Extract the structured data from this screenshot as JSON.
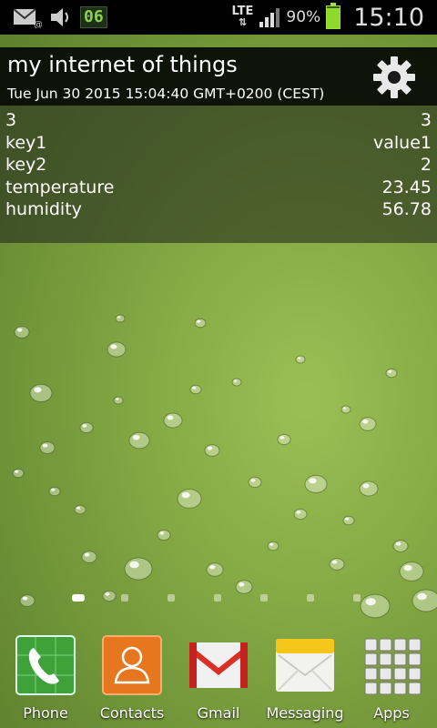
{
  "status_bar": {
    "notification_badge": "06",
    "network_type": "LTE",
    "battery_percent": "90%",
    "battery_level": 0.9,
    "clock": "15:10",
    "icons": [
      "email-notification-icon",
      "volume-icon",
      "signal-icon",
      "battery-icon"
    ]
  },
  "widget": {
    "title": "my internet of things",
    "timestamp": "Tue Jun 30 2015 15:04:40 GMT+0200 (CEST)",
    "settings_icon": "gear-icon",
    "rows": [
      {
        "key": "3",
        "value": "3"
      },
      {
        "key": "key1",
        "value": "value1"
      },
      {
        "key": "key2",
        "value": "2"
      },
      {
        "key": "temperature",
        "value": "23.45"
      },
      {
        "key": "humidity",
        "value": "56.78"
      }
    ]
  },
  "pager": {
    "pages": 7,
    "current_page": 1
  },
  "dock": {
    "apps": [
      {
        "label": "Phone",
        "icon": "phone-icon"
      },
      {
        "label": "Contacts",
        "icon": "contacts-icon"
      },
      {
        "label": "Gmail",
        "icon": "gmail-icon"
      },
      {
        "label": "Messaging",
        "icon": "messaging-icon"
      },
      {
        "label": "Apps",
        "icon": "apps-grid-icon"
      }
    ]
  },
  "colors": {
    "wallpaper": "#86aa44",
    "status_bar": "#000000",
    "battery": "#8fd82e",
    "badge_text": "#8bd14a"
  }
}
